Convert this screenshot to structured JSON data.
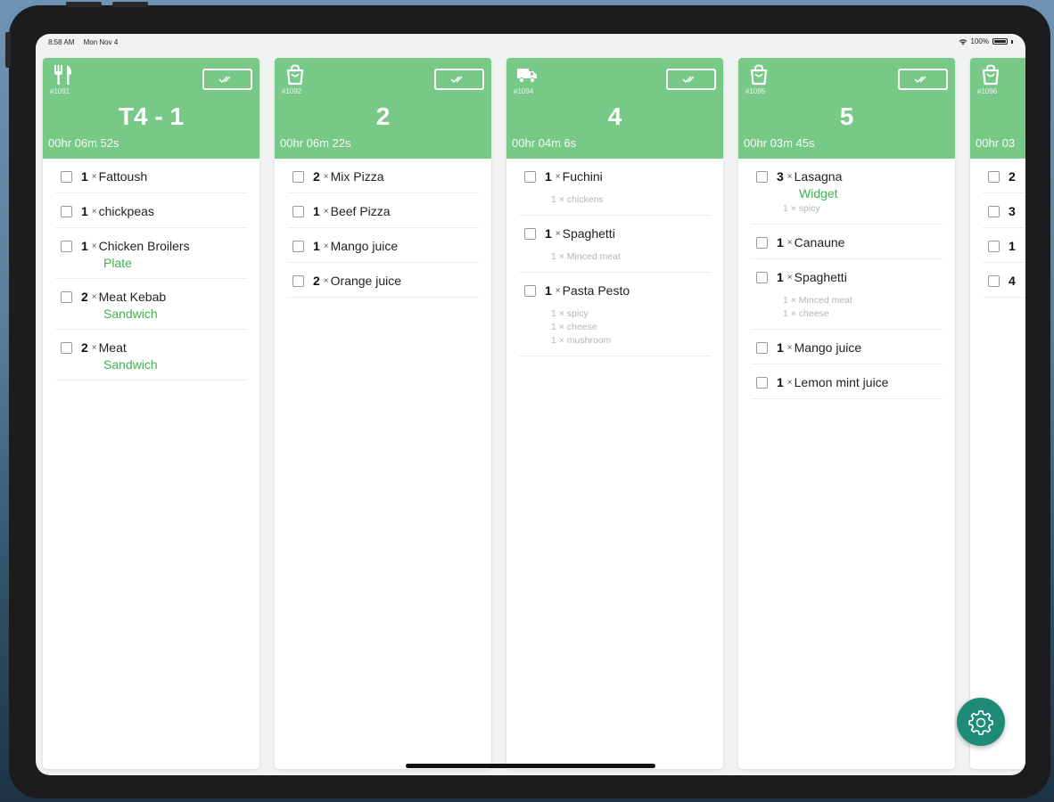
{
  "status_bar": {
    "time": "8:58 AM",
    "date": "Mon Nov 4",
    "battery": "100%"
  },
  "colors": {
    "header": "#78c887",
    "variant": "#3fb34f",
    "fab": "#1e8b76"
  },
  "orders": [
    {
      "type_icon": "fork-knife-icon",
      "number": "#1091",
      "table": "T4 - 1",
      "elapsed": "00hr 06m 52s",
      "items": [
        {
          "qty": "1",
          "x": "×",
          "name": "Fattoush",
          "variant": "",
          "mods": []
        },
        {
          "qty": "1",
          "x": "×",
          "name": "chickpeas",
          "variant": "",
          "mods": []
        },
        {
          "qty": "1",
          "x": "×",
          "name": "Chicken Broilers",
          "variant": "Plate",
          "mods": []
        },
        {
          "qty": "2",
          "x": "×",
          "name": "Meat Kebab",
          "variant": "Sandwich",
          "mods": []
        },
        {
          "qty": "2",
          "x": "×",
          "name": "Meat",
          "variant": "Sandwich",
          "mods": []
        }
      ]
    },
    {
      "type_icon": "bag-icon",
      "number": "#1092",
      "table": "2",
      "elapsed": "00hr 06m 22s",
      "items": [
        {
          "qty": "2",
          "x": "×",
          "name": "Mix Pizza",
          "variant": "",
          "mods": []
        },
        {
          "qty": "1",
          "x": "×",
          "name": "Beef Pizza",
          "variant": "",
          "mods": []
        },
        {
          "qty": "1",
          "x": "×",
          "name": "Mango juice",
          "variant": "",
          "mods": []
        },
        {
          "qty": "2",
          "x": "×",
          "name": "Orange juice",
          "variant": "",
          "mods": []
        }
      ]
    },
    {
      "type_icon": "delivery-truck-icon",
      "number": "#1094",
      "table": "4",
      "elapsed": "00hr 04m 6s",
      "items": [
        {
          "qty": "1",
          "x": "×",
          "name": "Fuchini",
          "variant": "",
          "mods": [
            "1 × chickens"
          ]
        },
        {
          "qty": "1",
          "x": "×",
          "name": "Spaghetti",
          "variant": "",
          "mods": [
            "1 × Minced meat"
          ]
        },
        {
          "qty": "1",
          "x": "×",
          "name": "Pasta Pesto",
          "variant": "",
          "mods": [
            "1 × spicy",
            "1 × cheese",
            "1 × mushroom"
          ]
        }
      ]
    },
    {
      "type_icon": "bag-icon",
      "number": "#1095",
      "table": "5",
      "elapsed": "00hr 03m 45s",
      "items": [
        {
          "qty": "3",
          "x": "×",
          "name": "Lasagna",
          "variant": "Widget",
          "mods": [
            "1 × spicy"
          ]
        },
        {
          "qty": "1",
          "x": "×",
          "name": "Canaune",
          "variant": "",
          "mods": []
        },
        {
          "qty": "1",
          "x": "×",
          "name": "Spaghetti",
          "variant": "",
          "mods": [
            "1 × Minced meat",
            "1 × cheese"
          ]
        },
        {
          "qty": "1",
          "x": "×",
          "name": "Mango juice",
          "variant": "",
          "mods": []
        },
        {
          "qty": "1",
          "x": "×",
          "name": "Lemon mint juice",
          "variant": "",
          "mods": []
        }
      ]
    },
    {
      "type_icon": "bag-icon",
      "number": "#1096",
      "table": "",
      "elapsed": "00hr 03",
      "items": [
        {
          "qty": "2",
          "x": "",
          "name": "",
          "variant": "",
          "mods": []
        },
        {
          "qty": "3",
          "x": "",
          "name": "",
          "variant": "",
          "mods": []
        },
        {
          "qty": "1",
          "x": "",
          "name": "",
          "variant": "",
          "mods": []
        },
        {
          "qty": "4",
          "x": "",
          "name": "",
          "variant": "",
          "mods": []
        }
      ]
    }
  ],
  "fab": {
    "icon": "gear-icon"
  }
}
